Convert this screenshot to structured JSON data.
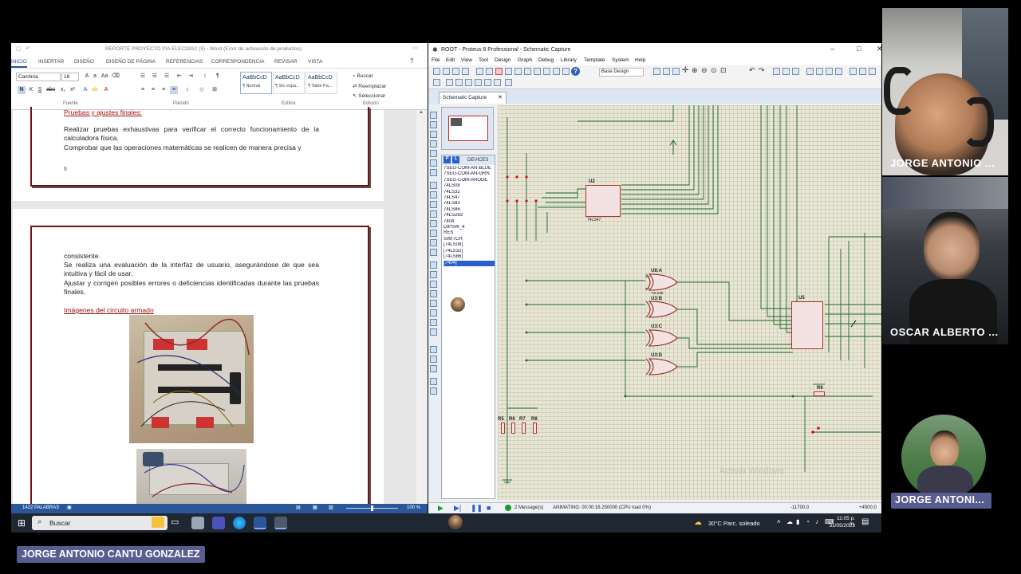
{
  "word": {
    "title": "REPORTE PROYECTO PIA ELECDIG2 (5) - Word (Error de activación de productos)",
    "tabs": [
      "INICIO",
      "INSERTAR",
      "DISEÑO",
      "DISEÑO DE PÁGINA",
      "REFERENCIAS",
      "CORRESPONDENCIA",
      "REVISAR",
      "VISTA"
    ],
    "font_name": "Cambria",
    "font_size": "16",
    "styles": [
      {
        "preview": "AaBbCcD",
        "name": "¶ Normal"
      },
      {
        "preview": "AaBbCcD",
        "name": "¶ Sin espa..."
      },
      {
        "preview": "AaBbCcD",
        "name": "¶ Table Pa..."
      }
    ],
    "edit": {
      "find": "Buscar",
      "replace": "Reemplazar",
      "select": "Seleccionar"
    },
    "groups": {
      "font": "Fuente",
      "paragraph": "Párrafo",
      "styles": "Estilos",
      "editing": "Edición"
    },
    "page1": {
      "heading": "Pruebas y ajustes finales:",
      "para1": "Realizar pruebas exhaustivas para verificar el correcto funcionamiento de la calculadora física.",
      "para2": "Comprobar que las operaciones matemáticas se realicen de manera precisa y",
      "page_number": "6"
    },
    "page2": {
      "line1": "consistente.",
      "para1": "Se realiza una evaluación de la interfaz de usuario, asegurándose de que sea intuitiva y fácil de usar.",
      "para2": "Ajustar y corrigen posibles errores o deficiencias identificadas durante las pruebas finales.",
      "heading": "Imágenes del circuito armado"
    },
    "status": {
      "words": "1422 PALABRAS",
      "zoom": "100 %"
    }
  },
  "proteus": {
    "title": "ROOT - Proteus 8 Professional - Schematic Capture",
    "menu": [
      "File",
      "Edit",
      "View",
      "Tool",
      "Design",
      "Graph",
      "Debug",
      "Library",
      "Template",
      "System",
      "Help"
    ],
    "design_select": "Base Design",
    "tab": "Schematic Capture",
    "devices_header": "DEVICES",
    "devices": [
      "7SEG-COM-AN-BLUE",
      "7SEG-COM-AN-GRN",
      "7SEG-COM-ANODE",
      "74LS08",
      "74LS32",
      "74LS47",
      "74LS83",
      "74LS86",
      "74LS283",
      "7404",
      "DIPSW_4",
      "RES",
      "SWITCH",
      "[74LS08]",
      "[74LS32]",
      "[74LS86]",
      "[7404]"
    ],
    "selected_device": "[7404]",
    "chips": {
      "u2": "U2",
      "u2_part": "74LS47",
      "u8a": "U8:A",
      "u3b": "U3:B",
      "u3c": "U3:C",
      "u3d": "U3:D",
      "u5": "U5",
      "r9": "R9",
      "r5": "R5",
      "r6": "R6",
      "r7": "R7",
      "r8": "R8"
    },
    "gate_part": "74LS86",
    "status": {
      "messages": "2 Message(s)",
      "animating": "ANIMATING: 00:00:16.250000 (CPU load 0%)",
      "x": "-11700.0",
      "y": "+4500.0"
    },
    "watermark": "Activar Windows"
  },
  "taskbar": {
    "search": "Buscar",
    "weather": "30°C  Parc. soleado",
    "time": "11:05 p. m.",
    "date": "31/05/2023"
  },
  "participants": {
    "p1": "JORGE ANTONIO ...",
    "p2": "OSCAR ALBERTO ...",
    "p3": "JORGE ANTONI...",
    "presenter": "JORGE ANTONIO CANTU GONZALEZ"
  }
}
